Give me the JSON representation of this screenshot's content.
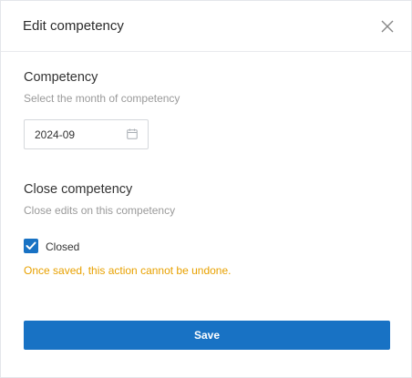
{
  "dialog": {
    "title": "Edit competency",
    "close_icon": "close-icon"
  },
  "competency": {
    "title": "Competency",
    "description": "Select the month of competency",
    "month_value": "2024-09",
    "picker_icon": "calendar-icon"
  },
  "close_competency": {
    "title": "Close competency",
    "description": "Close edits on this competency",
    "checkbox_label": "Closed",
    "checked": true,
    "warning": "Once saved, this action cannot be undone."
  },
  "actions": {
    "save_label": "Save"
  },
  "colors": {
    "primary": "#1872c4",
    "warning": "#e8a100",
    "muted_text": "#9a9a9a"
  }
}
